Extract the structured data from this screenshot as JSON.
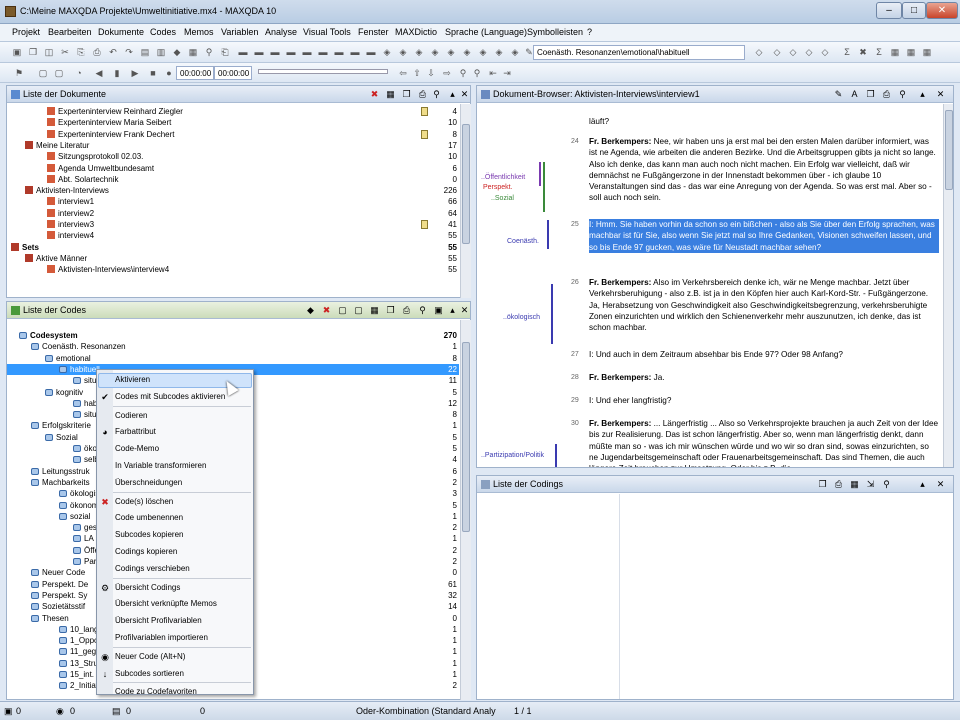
{
  "window": {
    "title": "C:\\Meine MAXQDA Projekte\\Umweltinitiative.mx4 - MAXQDA 10",
    "min": "–",
    "max": "□",
    "close": "✕"
  },
  "menu": [
    "Projekt",
    "Bearbeiten",
    "Dokumente",
    "Codes",
    "Memos",
    "Variablen",
    "Analyse",
    "Visual Tools",
    "Fenster",
    "MAXDictio",
    "Sprache (Language)",
    "Symbolleisten",
    "?"
  ],
  "toolbar": {
    "code_path": "Coenästh. Resonanzen\\emotional\\habituell",
    "zoom_a": "00:00:00",
    "zoom_b": "00:00:00"
  },
  "doc_list": {
    "title": "Liste der Dokumente",
    "rows": [
      {
        "label": "Experteninterview Reinhard Ziegler",
        "count": "4",
        "memo": true
      },
      {
        "label": "Experteninterview Maria Seibert",
        "count": "10",
        "memo": false
      },
      {
        "label": "Experteninterview Frank Dechert",
        "count": "8",
        "memo": true
      },
      {
        "label": "Meine Literatur",
        "count": "17",
        "memo": false
      },
      {
        "label": "Sitzungsprotokoll 02.03.",
        "count": "10",
        "memo": false
      },
      {
        "label": "Agenda Umweltbundesamt",
        "count": "6",
        "memo": false
      },
      {
        "label": "Abt. Solartechnik",
        "count": "0",
        "memo": false
      },
      {
        "label": "Aktivisten-Interviews",
        "count": "226",
        "memo": false
      },
      {
        "label": "interview1",
        "count": "66",
        "memo": false
      },
      {
        "label": "interview2",
        "count": "64",
        "memo": false
      },
      {
        "label": "interview3",
        "count": "41",
        "memo": true
      },
      {
        "label": "interview4",
        "count": "55",
        "memo": false
      },
      {
        "label": "Sets",
        "count": "55",
        "memo": false
      },
      {
        "label": "Aktive Männer",
        "count": "55",
        "memo": false
      },
      {
        "label": "Aktivisten-Interviews\\interview4",
        "count": "55",
        "memo": false
      }
    ]
  },
  "code_list": {
    "title": "Liste der Codes",
    "rows": [
      {
        "label": "Codesystem",
        "count": "270"
      },
      {
        "label": "Coenästh. Resonanzen",
        "count": "1"
      },
      {
        "label": "emotional",
        "count": "8"
      },
      {
        "label": "habituell",
        "count": "22"
      },
      {
        "label": "situa",
        "count": "11"
      },
      {
        "label": "kognitiv",
        "count": "5"
      },
      {
        "label": "habit",
        "count": "12"
      },
      {
        "label": "situa",
        "count": "8"
      },
      {
        "label": "Erfolgskriterie",
        "count": "1"
      },
      {
        "label": "Sozial",
        "count": "5"
      },
      {
        "label": "ökolo",
        "count": "5"
      },
      {
        "label": "selbs",
        "count": "4"
      },
      {
        "label": "Leitungsstruk",
        "count": "6"
      },
      {
        "label": "Machbarkeits",
        "count": "2"
      },
      {
        "label": "ökologisch",
        "count": "3"
      },
      {
        "label": "ökonomis",
        "count": "5"
      },
      {
        "label": "sozial",
        "count": "1"
      },
      {
        "label": "gese",
        "count": "2"
      },
      {
        "label": "LA 2",
        "count": "1"
      },
      {
        "label": "Öffe",
        "count": "2"
      },
      {
        "label": "Partiz",
        "count": "2"
      },
      {
        "label": "Neuer Code",
        "count": "0"
      },
      {
        "label": "Perspekt. De",
        "count": "61"
      },
      {
        "label": "Perspekt. Sy",
        "count": "32"
      },
      {
        "label": "Sozietätsstif",
        "count": "14"
      },
      {
        "label": "Thesen",
        "count": "0"
      },
      {
        "label": "10_langf",
        "count": "1"
      },
      {
        "label": "1_Oppos",
        "count": "1"
      },
      {
        "label": "11_geget",
        "count": "1"
      },
      {
        "label": "13_Struk",
        "count": "1"
      },
      {
        "label": "15_int. b",
        "count": "1"
      },
      {
        "label": "2_Initiati",
        "count": "2"
      }
    ]
  },
  "context_menu": [
    {
      "label": "Aktivieren",
      "icon": "",
      "sep": false
    },
    {
      "label": "Codes mit Subcodes aktivieren",
      "icon": "✔",
      "sep": false
    },
    {
      "label": "Codieren",
      "icon": "",
      "sep": true
    },
    {
      "label": "Farbattribut",
      "icon": "◕",
      "sep": false
    },
    {
      "label": "Code-Memo",
      "icon": "",
      "sep": false
    },
    {
      "label": "In Variable transformieren",
      "icon": "",
      "sep": false
    },
    {
      "label": "Überschneidungen",
      "icon": "",
      "sep": false
    },
    {
      "label": "Code(s) löschen",
      "icon": "✖",
      "sep": true
    },
    {
      "label": "Code umbenennen",
      "icon": "",
      "sep": false
    },
    {
      "label": "Subcodes kopieren",
      "icon": "",
      "sep": false
    },
    {
      "label": "Codings kopieren",
      "icon": "",
      "sep": false
    },
    {
      "label": "Codings verschieben",
      "icon": "",
      "sep": false
    },
    {
      "label": "Übersicht Codings",
      "icon": "⚙",
      "sep": true
    },
    {
      "label": "Übersicht verknüpfte Memos",
      "icon": "",
      "sep": false
    },
    {
      "label": "Übersicht Profilvariablen",
      "icon": "",
      "sep": false
    },
    {
      "label": "Profilvariablen importieren",
      "icon": "",
      "sep": false
    },
    {
      "label": "Neuer Code  (Alt+N)",
      "icon": "◉",
      "sep": true
    },
    {
      "label": "Subcodes sortieren",
      "icon": "↓",
      "sep": false
    },
    {
      "label": "Code zu Codefavoriten",
      "icon": "",
      "sep": true
    }
  ],
  "doc_browser": {
    "title": "Dokument-Browser: Aktivisten-Interviews\\interview1",
    "paras": [
      {
        "num": "",
        "text": "läuft?"
      },
      {
        "num": "24",
        "speaker": "Fr. Berkempers:",
        "text": " Nee, wir haben uns ja erst mal bei den ersten Malen darüber informiert, was ist ne Agenda, wie arbeiten die anderen Bezirke. Und die Arbeitsgruppen gibts ja nicht so lange. Also ich denke, das kann man auch noch nicht machen. Ein Erfolg war vielleicht, daß wir demnächst ne Fußgängerzone in der Innenstadt bekommen über - ich glaube 10 Veranstaltungen sind das - das war eine Anregung von der Agenda. So was erst mal. Aber so - soll auch noch sein."
      },
      {
        "num": "25",
        "speaker": "",
        "text": "I: Hmm. Sie haben vorhin da schon so ein bißchen - also als Sie über den Erfolg sprachen, was machbar ist für Sie, also wenn Sie jetzt mal so Ihre Gedanken, Visionen schweifen lassen, und so bis Ende 97 gucken, was wäre für Neustadt machbar sehen?"
      },
      {
        "num": "26",
        "speaker": "Fr. Berkempers:",
        "text": " Also im Verkehrsbereich denke ich, wär ne Menge machbar. Jetzt über Verkehrsberuhigung - also z.B. ist ja in den Köpfen hier auch Karl-Kord-Str. - Fußgängerzone. Ja, Herabsetzung von Geschwindigkeit also Geschwindigkeitsbegrenzung, verkehrsberuhigte Zonen einzurichten und wirklich den Schienenverkehr mehr auszunutzen, ich denke, das ist schon machbar."
      },
      {
        "num": "27",
        "speaker": "",
        "text": "I: Und auch in dem Zeitraum absehbar bis Ende 97? Oder 98 Anfang?"
      },
      {
        "num": "28",
        "speaker": "Fr. Berkempers:",
        "text": " Ja."
      },
      {
        "num": "29",
        "speaker": "",
        "text": "I: Und eher langfristig?"
      },
      {
        "num": "30",
        "speaker": "Fr. Berkempers:",
        "text": " ... Längerfristig ... Also so Verkehrsprojekte brauchen ja auch Zeit von der Idee bis zur Realisierung. Das ist schon längerfristig. Aber so, wenn man längerfristig denkt, dann müßte man so - was ich mir wünschen würde und wo wir so dran sind, sowas einzurichten, so ne Jugendarbeitsgemeinschaft oder Frauenarbeitsgemeinschaft. Das sind Themen, die auch längere Zeit brauchen zur Umsetzung. Oder bis z.B. die"
      }
    ],
    "codes": [
      "..Öffentlichkeit",
      "Perspekt.",
      "..Sozial",
      "Coenästh.",
      "..ökologisch",
      "..Partizipation/Politik"
    ]
  },
  "codings": {
    "title": "Liste der Codings"
  },
  "status": {
    "a": "0",
    "b": "0",
    "c": "0",
    "d": "0",
    "combo": "Oder-Kombination (Standard Analy",
    "pages": "1 / 1"
  },
  "colors": {
    "accent": "#3a8ee6",
    "selection": "#3399ff",
    "highlight": "#3a7fe0"
  }
}
